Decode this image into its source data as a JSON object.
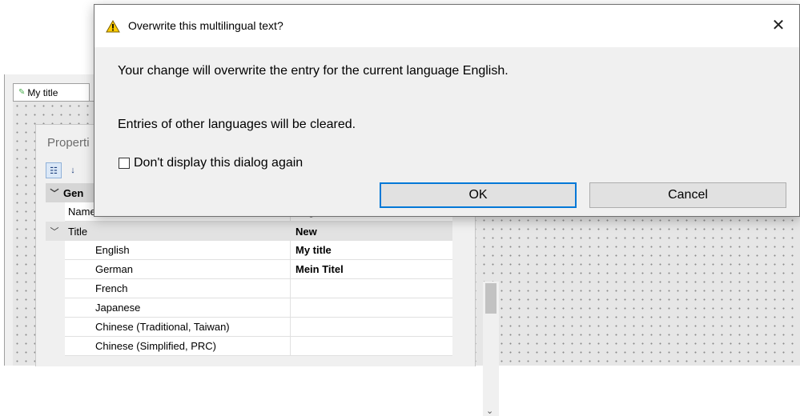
{
  "editor": {
    "doc_tab_label": "My title",
    "properties_title": "Properti",
    "grid": {
      "header_label": "Gen",
      "rows": [
        {
          "name": "Name",
          "value": "Page 1"
        },
        {
          "name": "Title",
          "value": "New"
        },
        {
          "name": "English",
          "value": "My title"
        },
        {
          "name": "German",
          "value": "Mein Titel"
        },
        {
          "name": "French",
          "value": ""
        },
        {
          "name": "Japanese",
          "value": ""
        },
        {
          "name": "Chinese (Traditional, Taiwan)",
          "value": ""
        },
        {
          "name": "Chinese (Simplified, PRC)",
          "value": ""
        }
      ]
    }
  },
  "dialog": {
    "title": "Overwrite this multilingual text?",
    "message1": "Your change will overwrite the entry for the current language English.",
    "message2": "Entries of other languages will be cleared.",
    "checkbox_label": "Don't display this dialog again",
    "ok_label": "OK",
    "cancel_label": "Cancel",
    "accent_color": "#0078d7"
  }
}
